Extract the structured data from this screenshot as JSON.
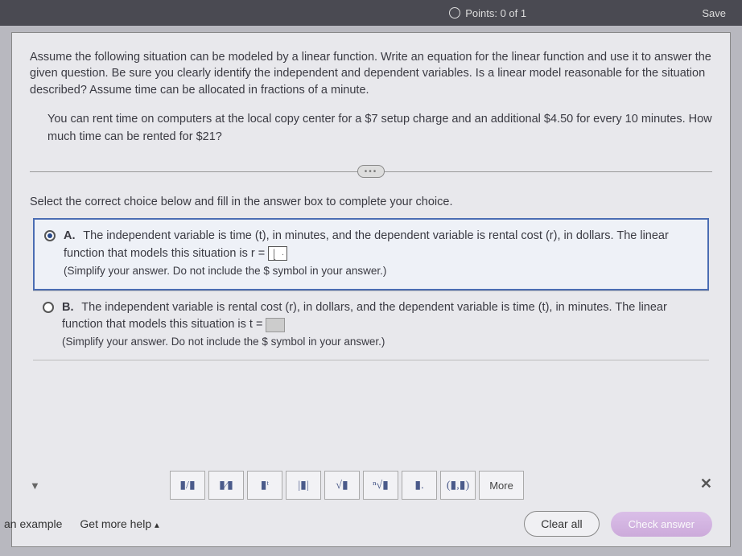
{
  "topbar": {
    "points_label": "Points: 0 of 1",
    "save_label": "Save"
  },
  "problem": {
    "intro": "Assume the following situation can be modeled by a linear function. Write an equation for the linear function and use it to answer the given question. Be sure you clearly identify the independent and dependent variables. Is a linear model reasonable for the situation described? Assume time can be allocated in fractions of a minute.",
    "scenario": "You can rent time on computers at the local copy center for a $7 setup charge and an additional $4.50 for every 10 minutes. How much time can be rented for $21?"
  },
  "instruction": "Select the correct choice below and fill in the answer box to complete your choice.",
  "choices": {
    "a": {
      "label": "A.",
      "text1": "The independent variable is time (t), in minutes, and the dependent variable is rental cost (r), in dollars. The linear function that models this situation is r =",
      "note": "(Simplify your answer. Do not include the $ symbol in your answer.)"
    },
    "b": {
      "label": "B.",
      "text1": "The independent variable is rental cost (r), in dollars, and the dependent variable is time (t), in minutes. The linear function that models this situation is t =",
      "note": "(Simplify your answer. Do not include the $ symbol in your answer.)"
    }
  },
  "palette": {
    "frac": "▮/▮",
    "mixed": "▮⁄▮",
    "exp": "▮ᵗ",
    "abs": "|▮|",
    "sqrt": "√▮",
    "nroot": "ⁿ√▮",
    "sub": "▮.",
    "pair": "(▮,▮)",
    "more": "More"
  },
  "footer": {
    "example": "an example",
    "help": "Get more help",
    "clear": "Clear all",
    "check": "Check answer"
  }
}
